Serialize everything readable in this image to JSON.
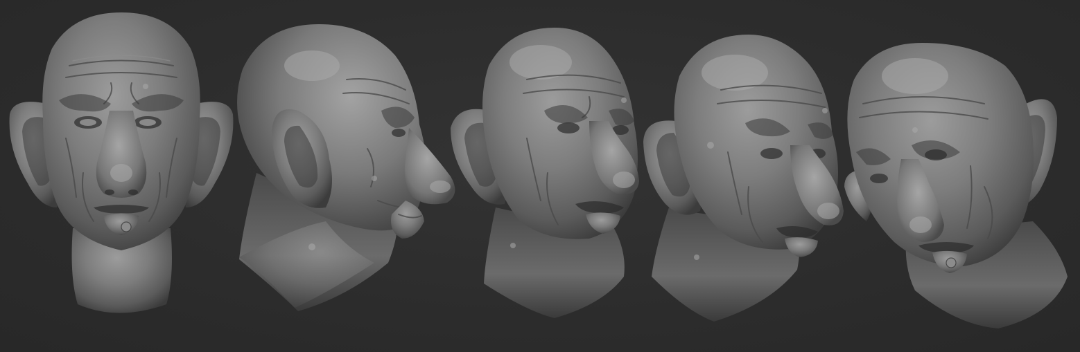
{
  "scene": {
    "background_color": "#2d2d2d",
    "model_color": "#7a7a7a",
    "views": [
      {
        "id": "front",
        "icon": "bust-front-view"
      },
      {
        "id": "side-right",
        "icon": "bust-profile-view"
      },
      {
        "id": "three-quarter-right",
        "icon": "bust-three-quarter-view"
      },
      {
        "id": "three-quarter-right-low",
        "icon": "bust-three-quarter-low-view"
      },
      {
        "id": "three-quarter-left",
        "icon": "bust-three-quarter-left-view"
      }
    ]
  }
}
